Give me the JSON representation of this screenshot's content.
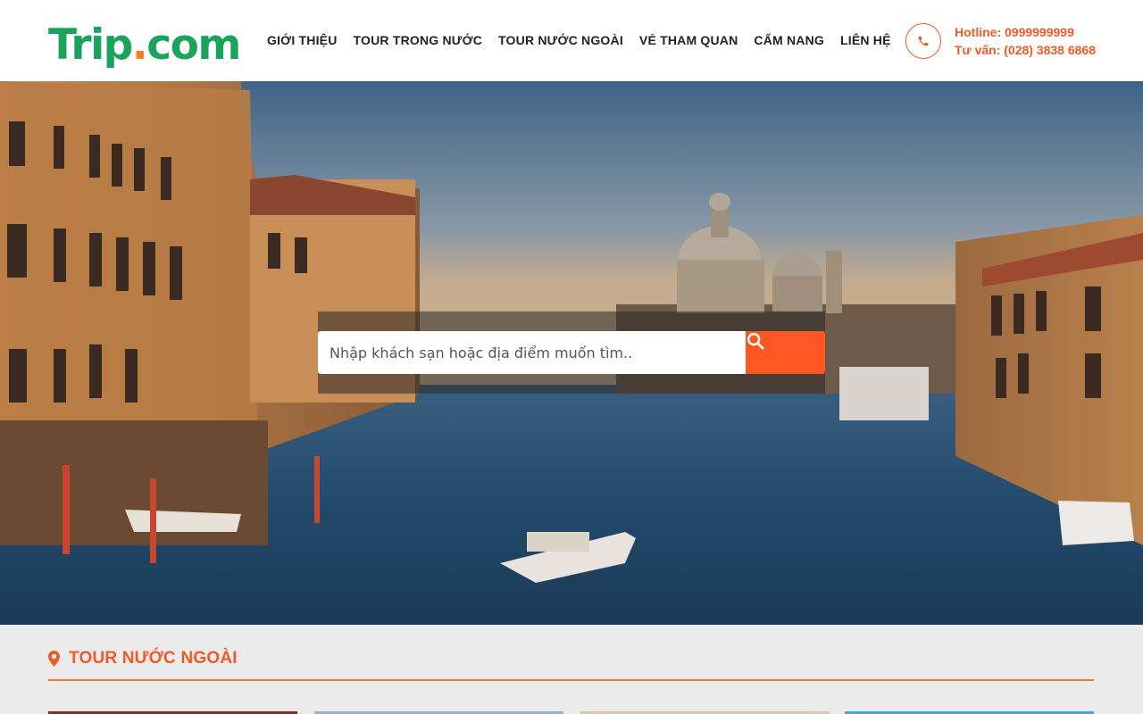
{
  "header": {
    "logo_main": "Trip",
    "logo_dot": ".",
    "logo_tld": "com",
    "nav": [
      {
        "label": "GIỚI THIỆU"
      },
      {
        "label": "TOUR TRONG NƯỚC"
      },
      {
        "label": "TOUR NƯỚC NGOÀI"
      },
      {
        "label": "VÉ THAM QUAN"
      },
      {
        "label": "CẨM NANG"
      },
      {
        "label": "LIÊN HỆ"
      }
    ],
    "hotline": "Hotline: 0999999999",
    "advice": "Tư vấn: (028) 3838 6868",
    "phone_icon": "phone-icon"
  },
  "search": {
    "placeholder": "Nhập khách sạn hoặc địa điểm muốn tìm..",
    "button_icon": "search-icon"
  },
  "section": {
    "title": "TOUR NƯỚC NGOÀI",
    "icon": "map-pin-icon"
  },
  "colors": {
    "brand_green": "#1aa35a",
    "accent_orange": "#f05a28",
    "search_button": "#ff5722"
  }
}
